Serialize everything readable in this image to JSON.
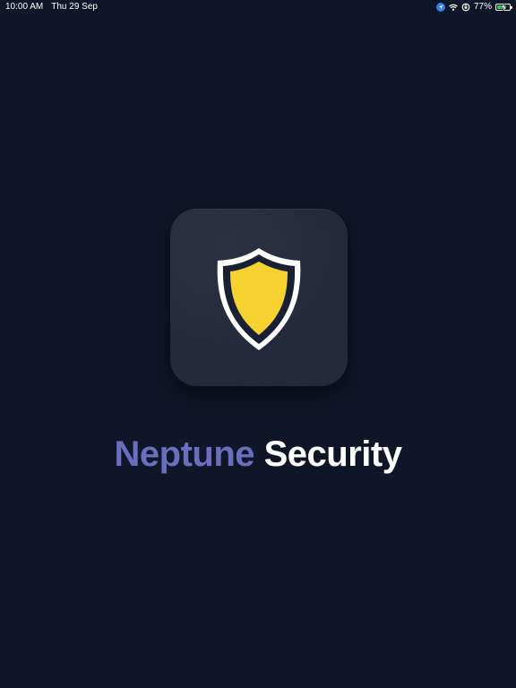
{
  "status_bar": {
    "time": "10:00 AM",
    "date": "Thu 29 Sep",
    "battery_percent": "77%",
    "battery_level": 0.77,
    "icons": [
      "location-arrow-icon",
      "wifi-icon",
      "orientation-lock-icon",
      "battery-charging-icon"
    ]
  },
  "app": {
    "title_part_1": "Neptune",
    "title_part_2": "Security",
    "icon": "shield-icon"
  },
  "colors": {
    "background": "#0e1627",
    "icon_tile": "#1e2536",
    "shield_fill": "#f5d230",
    "shield_outline": "#ffffff",
    "title_accent": "#6a6fbd",
    "title_main": "#ffffff",
    "location_blue": "#2f80ed",
    "battery_green": "#34c759"
  }
}
